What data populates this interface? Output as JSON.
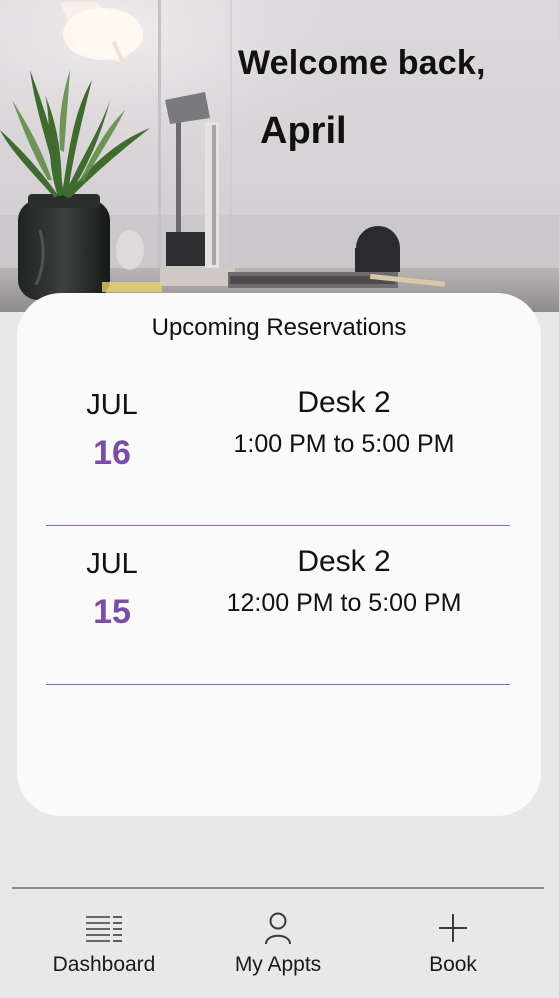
{
  "header": {
    "greeting": "Welcome back,",
    "user_name": "April"
  },
  "reservations": {
    "title": "Upcoming Reservations",
    "items": [
      {
        "month": "JUL",
        "day": "16",
        "desk": "Desk 2",
        "time": "1:00 PM to 5:00 PM"
      },
      {
        "month": "JUL",
        "day": "15",
        "desk": "Desk 2",
        "time": "12:00 PM to 5:00 PM"
      }
    ]
  },
  "nav": {
    "dashboard": {
      "label": "Dashboard",
      "icon": "dashboard-list-icon"
    },
    "appointments": {
      "label": "My Appts",
      "icon": "person-icon"
    },
    "book": {
      "label": "Book",
      "icon": "plus-icon"
    }
  },
  "colors": {
    "accent": "#7a4ea6",
    "card_background": "#fbfafb",
    "page_background": "#e8e8e9"
  }
}
